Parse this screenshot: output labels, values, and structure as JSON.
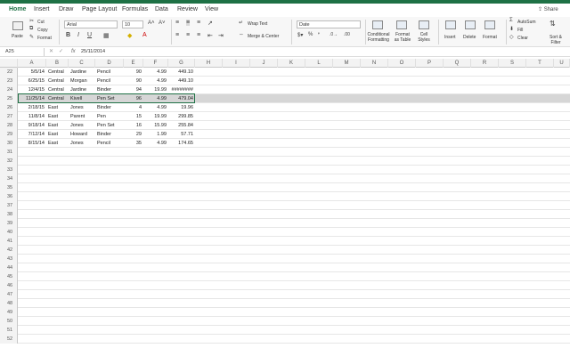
{
  "tabs": [
    "Home",
    "Insert",
    "Draw",
    "Page Layout",
    "Formulas",
    "Data",
    "Review",
    "View"
  ],
  "share_label": "Share",
  "ribbon": {
    "paste_label": "Paste",
    "cut_label": "Cut",
    "copy_label": "Copy",
    "format_label": "Format",
    "font_name": "Arial",
    "font_size": "10",
    "wrap_text_label": "Wrap Text",
    "merge_center_label": "Merge & Center",
    "number_format": "Date",
    "conditional_formatting_label": "Conditional Formatting",
    "format_as_table_label": "Format as Table",
    "cell_styles_label": "Cell Styles",
    "insert_label": "Insert",
    "delete_label": "Delete",
    "format_cells_label": "Format",
    "autosum_label": "AutoSum",
    "fill_label": "Fill",
    "clear_label": "Clear",
    "sort_filter_label": "Sort & Filter"
  },
  "formula_bar": {
    "name_box": "A25",
    "fx": "fx",
    "value": "25/11/2014"
  },
  "columns": [
    "A",
    "B",
    "C",
    "D",
    "E",
    "F",
    "G",
    "H",
    "I",
    "J",
    "K",
    "L",
    "M",
    "N",
    "O",
    "P",
    "Q",
    "R",
    "S",
    "T",
    "U"
  ],
  "rows": [
    {
      "num": "22",
      "cells": [
        "5/5/14",
        "Central",
        "Jardine",
        "Pencil",
        "90",
        "4.99",
        "449.10"
      ]
    },
    {
      "num": "23",
      "cells": [
        "6/25/15",
        "Central",
        "Morgan",
        "Pencil",
        "90",
        "4.99",
        "449.10"
      ]
    },
    {
      "num": "24",
      "cells": [
        "12/4/15",
        "Central",
        "Jardine",
        "Binder",
        "94",
        "19.99",
        "########"
      ]
    },
    {
      "num": "25",
      "cells": [
        "11/25/14",
        "Central",
        "Kivell",
        "Pen Set",
        "96",
        "4.99",
        "479.04"
      ]
    },
    {
      "num": "26",
      "cells": [
        "2/18/15",
        "East",
        "Jones",
        "Binder",
        "4",
        "4.99",
        "19.96"
      ]
    },
    {
      "num": "27",
      "cells": [
        "11/8/14",
        "East",
        "Parent",
        "Pen",
        "15",
        "19.99",
        "299.85"
      ]
    },
    {
      "num": "28",
      "cells": [
        "9/18/14",
        "East",
        "Jones",
        "Pen Set",
        "16",
        "15.99",
        "255.84"
      ]
    },
    {
      "num": "29",
      "cells": [
        "7/12/14",
        "East",
        "Howard",
        "Binder",
        "29",
        "1.99",
        "57.71"
      ]
    },
    {
      "num": "30",
      "cells": [
        "8/15/14",
        "East",
        "Jones",
        "Pencil",
        "35",
        "4.99",
        "174.65"
      ]
    },
    {
      "num": "31",
      "cells": [
        "",
        "",
        "",
        "",
        "",
        "",
        ""
      ]
    },
    {
      "num": "32",
      "cells": [
        "",
        "",
        "",
        "",
        "",
        "",
        ""
      ]
    },
    {
      "num": "33",
      "cells": [
        "",
        "",
        "",
        "",
        "",
        "",
        ""
      ]
    },
    {
      "num": "34",
      "cells": [
        "",
        "",
        "",
        "",
        "",
        "",
        ""
      ]
    },
    {
      "num": "35",
      "cells": [
        "",
        "",
        "",
        "",
        "",
        "",
        ""
      ]
    },
    {
      "num": "36",
      "cells": [
        "",
        "",
        "",
        "",
        "",
        "",
        ""
      ]
    },
    {
      "num": "37",
      "cells": [
        "",
        "",
        "",
        "",
        "",
        "",
        ""
      ]
    },
    {
      "num": "38",
      "cells": [
        "",
        "",
        "",
        "",
        "",
        "",
        ""
      ]
    },
    {
      "num": "39",
      "cells": [
        "",
        "",
        "",
        "",
        "",
        "",
        ""
      ]
    },
    {
      "num": "40",
      "cells": [
        "",
        "",
        "",
        "",
        "",
        "",
        ""
      ]
    },
    {
      "num": "41",
      "cells": [
        "",
        "",
        "",
        "",
        "",
        "",
        ""
      ]
    },
    {
      "num": "42",
      "cells": [
        "",
        "",
        "",
        "",
        "",
        "",
        ""
      ]
    },
    {
      "num": "43",
      "cells": [
        "",
        "",
        "",
        "",
        "",
        "",
        ""
      ]
    },
    {
      "num": "44",
      "cells": [
        "",
        "",
        "",
        "",
        "",
        "",
        ""
      ]
    },
    {
      "num": "45",
      "cells": [
        "",
        "",
        "",
        "",
        "",
        "",
        ""
      ]
    },
    {
      "num": "46",
      "cells": [
        "",
        "",
        "",
        "",
        "",
        "",
        ""
      ]
    },
    {
      "num": "47",
      "cells": [
        "",
        "",
        "",
        "",
        "",
        "",
        ""
      ]
    },
    {
      "num": "48",
      "cells": [
        "",
        "",
        "",
        "",
        "",
        "",
        ""
      ]
    },
    {
      "num": "49",
      "cells": [
        "",
        "",
        "",
        "",
        "",
        "",
        ""
      ]
    },
    {
      "num": "50",
      "cells": [
        "",
        "",
        "",
        "",
        "",
        "",
        ""
      ]
    },
    {
      "num": "51",
      "cells": [
        "",
        "",
        "",
        "",
        "",
        "",
        ""
      ]
    },
    {
      "num": "52",
      "cells": [
        "",
        "",
        "",
        "",
        "",
        "",
        ""
      ]
    }
  ],
  "selected_row": "25",
  "colors": {
    "accent": "#1e7145",
    "selection_fill": "#d6d6d6"
  }
}
